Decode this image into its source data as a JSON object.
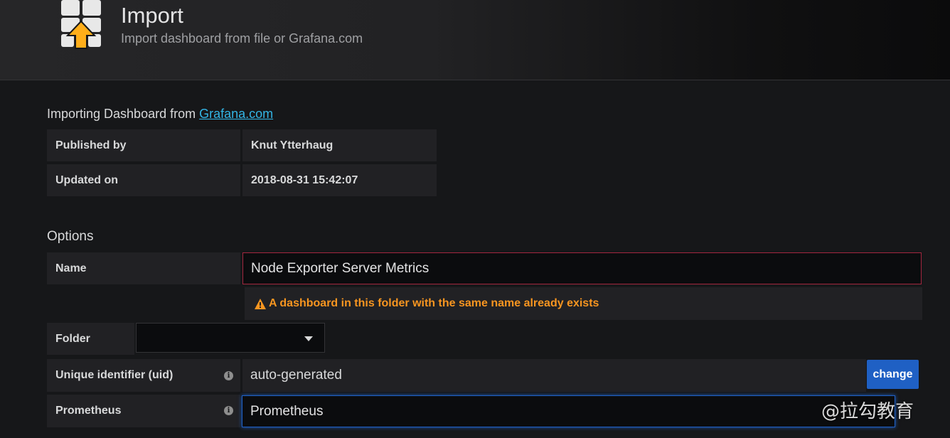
{
  "header": {
    "title": "Import",
    "subtitle": "Import dashboard from file or Grafana.com",
    "icon": "import-icon"
  },
  "import_from": {
    "prefix": "Importing Dashboard from ",
    "link": "Grafana.com"
  },
  "info_table": {
    "rows": [
      {
        "label": "Published by",
        "value": "Knut Ytterhaug"
      },
      {
        "label": "Updated on",
        "value": "2018-08-31 15:42:07"
      }
    ]
  },
  "options": {
    "title": "Options",
    "name_label": "Name",
    "name_value": "Node Exporter Server Metrics",
    "name_warning": "A dashboard in this folder with the same name already exists",
    "folder_label": "Folder",
    "folder_value": "",
    "uid_label": "Unique identifier (uid)",
    "uid_value": "auto-generated",
    "uid_change": "change",
    "prometheus_label": "Prometheus",
    "prometheus_value": "Prometheus"
  },
  "watermark": "@拉勾教育",
  "colors": {
    "accent": "#33b5e5",
    "warning": "#f79520",
    "error_border": "#a3273f",
    "primary_button": "#1f60c4",
    "icon_orange": "#ffae1a"
  }
}
